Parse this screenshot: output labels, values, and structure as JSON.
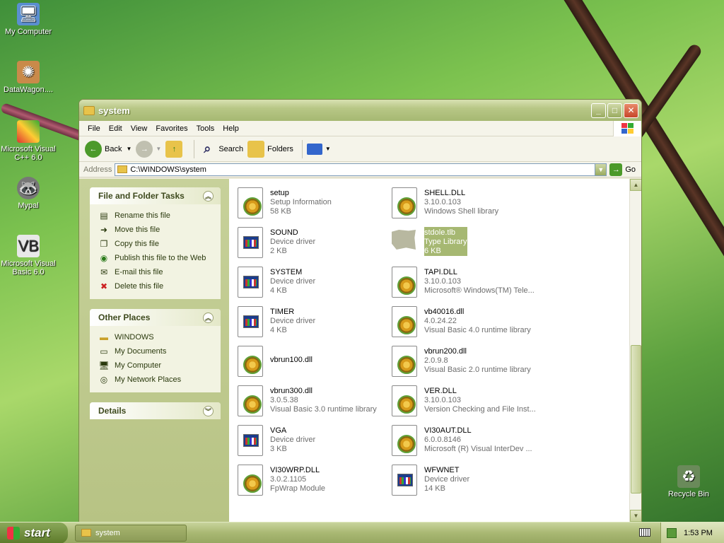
{
  "desktop": {
    "icons": [
      {
        "label": "My Computer",
        "icon": "my-computer-icon"
      },
      {
        "label": "DataWagon....",
        "icon": "datawagon-shortcut-icon"
      },
      {
        "label": "Microsoft Visual C++ 6.0",
        "icon": "visual-cpp-icon"
      },
      {
        "label": "Mypal",
        "icon": "mypal-icon"
      },
      {
        "label": "Microsoft Visual Basic 6.0",
        "icon": "visual-basic-icon"
      },
      {
        "label": "Recycle Bin",
        "icon": "recycle-bin-icon"
      }
    ]
  },
  "window": {
    "title": "system",
    "menu": [
      "File",
      "Edit",
      "View",
      "Favorites",
      "Tools",
      "Help"
    ],
    "toolbar": {
      "back": "Back",
      "search": "Search",
      "folders": "Folders"
    },
    "address": {
      "label": "Address",
      "value": "C:\\WINDOWS\\system",
      "go": "Go"
    }
  },
  "taskpane": {
    "file_tasks": {
      "title": "File and Folder Tasks",
      "items": [
        "Rename this file",
        "Move this file",
        "Copy this file",
        "Publish this file to the Web",
        "E-mail this file",
        "Delete this file"
      ]
    },
    "other_places": {
      "title": "Other Places",
      "items": [
        "WINDOWS",
        "My Documents",
        "My Computer",
        "My Network Places"
      ]
    },
    "details": {
      "title": "Details"
    }
  },
  "files": [
    {
      "name": "setup",
      "l1": "Setup Information",
      "l2": "58 KB",
      "kind": "inf"
    },
    {
      "name": "SHELL.DLL",
      "l1": "3.10.0.103",
      "l2": "Windows Shell library",
      "kind": "dll"
    },
    {
      "name": "SOUND",
      "l1": "Device driver",
      "l2": "2 KB",
      "kind": "drv"
    },
    {
      "name": "stdole.tlb",
      "l1": "Type Library",
      "l2": "6 KB",
      "kind": "tlb"
    },
    {
      "name": "SYSTEM",
      "l1": "Device driver",
      "l2": "4 KB",
      "kind": "drv"
    },
    {
      "name": "TAPI.DLL",
      "l1": "3.10.0.103",
      "l2": "Microsoft® Windows(TM) Tele...",
      "kind": "dll"
    },
    {
      "name": "TIMER",
      "l1": "Device driver",
      "l2": "4 KB",
      "kind": "drv"
    },
    {
      "name": "vb40016.dll",
      "l1": "4.0.24.22",
      "l2": "Visual Basic 4.0 runtime library",
      "kind": "dll"
    },
    {
      "name": "vbrun100.dll",
      "l1": "",
      "l2": "",
      "kind": "dll"
    },
    {
      "name": "vbrun200.dll",
      "l1": "2.0.9.8",
      "l2": "Visual Basic 2.0 runtime library",
      "kind": "dll"
    },
    {
      "name": "vbrun300.dll",
      "l1": "3.0.5.38",
      "l2": "Visual Basic 3.0 runtime library",
      "kind": "dll"
    },
    {
      "name": "VER.DLL",
      "l1": "3.10.0.103",
      "l2": "Version Checking and File Inst...",
      "kind": "dll"
    },
    {
      "name": "VGA",
      "l1": "Device driver",
      "l2": "3 KB",
      "kind": "drv"
    },
    {
      "name": "VI30AUT.DLL",
      "l1": "6.0.0.8146",
      "l2": "Microsoft (R) Visual InterDev ...",
      "kind": "dll"
    },
    {
      "name": "VI30WRP.DLL",
      "l1": "3.0.2.1105",
      "l2": "FpWrap Module",
      "kind": "dll"
    },
    {
      "name": "WFWNET",
      "l1": "Device driver",
      "l2": "14 KB",
      "kind": "drv"
    }
  ],
  "taskbar": {
    "start": "start",
    "task": "system",
    "clock": "1:53 PM"
  }
}
